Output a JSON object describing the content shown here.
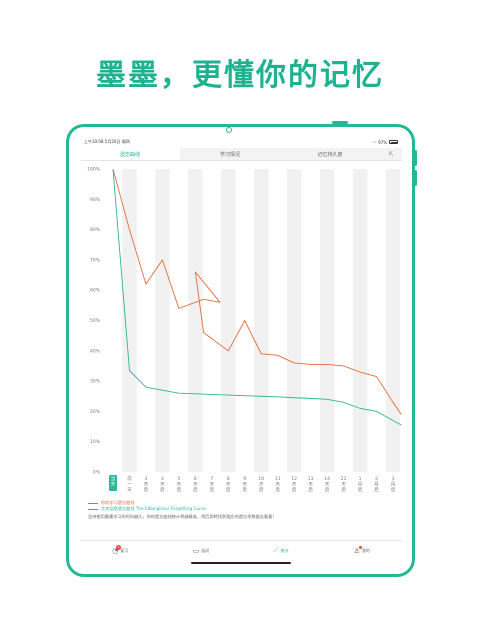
{
  "headline": "墨墨，更懂你的记忆",
  "status_bar": {
    "left": "上午10:08 5月20日 周四",
    "right": "97%"
  },
  "tabs": [
    {
      "label": "遗忘曲线",
      "active": true
    },
    {
      "label": "学习情况",
      "active": false
    },
    {
      "label": "记忆持久度",
      "active": false
    }
  ],
  "share_icon": "share-icon",
  "chart_data": {
    "type": "line",
    "y_ticks": [
      "100%",
      "90%",
      "80%",
      "70%",
      "60%",
      "50%",
      "40%",
      "30%",
      "20%",
      "10%",
      "0%"
    ],
    "ylim": [
      0,
      100
    ],
    "x_labels": [
      "当天",
      "前一天",
      "3天后",
      "4天后",
      "5天后",
      "6天后",
      "7天后",
      "8天后",
      "9天后",
      "10天后",
      "11天后",
      "12天后",
      "13天后",
      "14天后",
      "21天后",
      "1月后",
      "2月后",
      "3月后"
    ],
    "x_label_display": [
      [
        "当",
        "天"
      ],
      [
        "前",
        "一",
        "天"
      ],
      [
        "3",
        "天",
        "后"
      ],
      [
        "4",
        "天",
        "后"
      ],
      [
        "5",
        "天",
        "后"
      ],
      [
        "6",
        "天",
        "后"
      ],
      [
        "7",
        "天",
        "后"
      ],
      [
        "8",
        "天",
        "后"
      ],
      [
        "9",
        "天",
        "后"
      ],
      [
        "10",
        "天",
        "后"
      ],
      [
        "11",
        "天",
        "后"
      ],
      [
        "12",
        "天",
        "后"
      ],
      [
        "13",
        "天",
        "后"
      ],
      [
        "14",
        "天",
        "后"
      ],
      [
        "21",
        "天",
        "后"
      ],
      [
        "1",
        "月",
        "后"
      ],
      [
        "2",
        "月",
        "后"
      ],
      [
        "3",
        "月",
        "后"
      ]
    ],
    "highlight_index": 0,
    "series": [
      {
        "name": "你的学习遗忘曲线",
        "color": "#e06c3c",
        "x": [
          0,
          1,
          2,
          3,
          4,
          5.5,
          6.5,
          5,
          5.5,
          7,
          8,
          9,
          10,
          11,
          12,
          13,
          14,
          15,
          16,
          17,
          17.5
        ],
        "values": [
          100,
          80,
          62,
          70,
          54,
          57,
          56,
          66,
          46,
          40,
          50,
          39,
          38.5,
          36,
          35.5,
          35.5,
          35,
          33,
          31.5,
          23,
          19
        ]
      },
      {
        "name": "艾宾浩斯遗忘曲线 The Ebbinghaus Forgetting Curve",
        "color": "#2bb59a",
        "x": [
          0,
          1,
          2,
          3,
          4,
          5,
          6,
          7,
          8,
          9,
          10,
          11,
          12,
          13,
          14,
          15,
          16,
          17,
          17.5
        ],
        "values": [
          100,
          33.5,
          28,
          27,
          26,
          25.8,
          25.6,
          25.4,
          25.2,
          25,
          24.8,
          24.5,
          24.3,
          24,
          23,
          21,
          20,
          17,
          15.5
        ]
      }
    ]
  },
  "note": "坚持使用墨墨学习的时间越久，你的遗忘曲线统计将越精准，然后即将找到相应的遗忘率数据去看看！",
  "bottom_nav": [
    {
      "label": "复习",
      "icon": "review-icon",
      "badge": "1",
      "active": false
    },
    {
      "label": "选词",
      "icon": "book-icon",
      "active": false
    },
    {
      "label": "统计",
      "icon": "chart-icon",
      "active": true
    },
    {
      "label": "我的",
      "icon": "user-icon",
      "dot": true,
      "active": false
    }
  ]
}
